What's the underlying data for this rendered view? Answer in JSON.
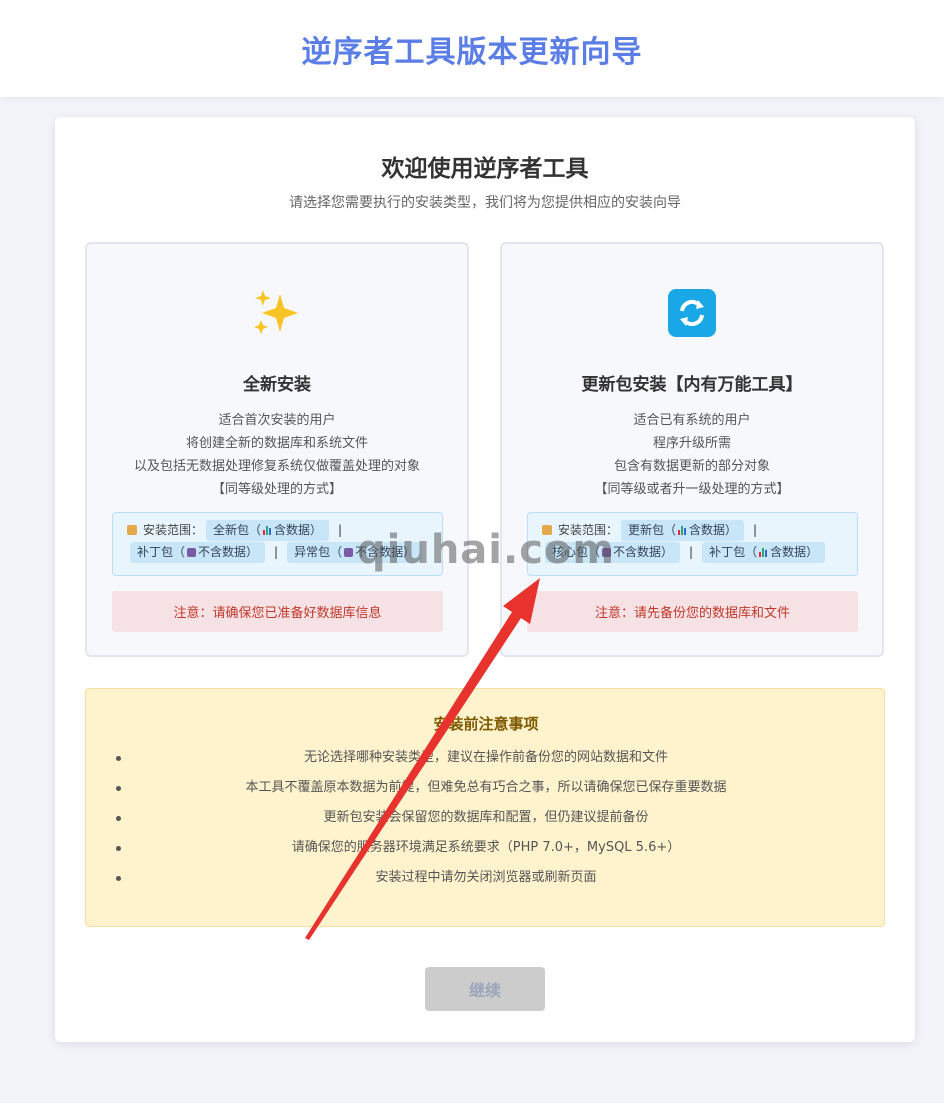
{
  "header": {
    "title": "逆序者工具版本更新向导"
  },
  "welcome": {
    "title": "欢迎使用逆序者工具",
    "subtitle": "请选择您需要执行的安装类型，我们将为您提供相应的安装向导"
  },
  "options": [
    {
      "icon": "sparkles-icon",
      "title": "全新安装",
      "desc": [
        "适合首次安装的用户",
        "将创建全新的数据库和系统文件",
        "以及包括无数据处理修复系统仅做覆盖处理的对象",
        "【同等级处理的方式】"
      ],
      "scope_label": "安装范围：",
      "tags_row1": [
        "全新包（",
        "含数据）"
      ],
      "tags_row2a": [
        "补丁包（",
        "不含数据）"
      ],
      "tags_row2b": [
        "异常包（",
        "不含数据）"
      ],
      "separator": "|",
      "warning": "注意：请确保您已准备好数据库信息"
    },
    {
      "icon": "refresh-icon",
      "title": "更新包安装【内有万能工具】",
      "desc": [
        "适合已有系统的用户",
        "程序升级所需",
        "包含有数据更新的部分对象",
        "【同等级或者升一级处理的方式】"
      ],
      "scope_label": "安装范围：",
      "tags_row1": [
        "更新包（",
        "含数据）"
      ],
      "tags_row2a": [
        "核心包（",
        "不含数据）"
      ],
      "tags_row2b": [
        "补丁包（",
        "含数据）"
      ],
      "separator": "|",
      "warning": "注意：请先备份您的数据库和文件"
    }
  ],
  "notes": {
    "title": "安装前注意事项",
    "items": [
      "无论选择哪种安装类型，建议在操作前备份您的网站数据和文件",
      "本工具不覆盖原本数据为前提，但难免总有巧合之事，所以请确保您已保存重要数据",
      "更新包安装会保留您的数据库和配置，但仍建议提前备份",
      "请确保您的服务器环境满足系统要求（PHP 7.0+，MySQL 5.6+）",
      "安装过程中请勿关闭浏览器或刷新页面"
    ]
  },
  "continue_label": "继续",
  "watermark": "qiuhai.com",
  "colors": {
    "accent": "#5b7ee6",
    "warning_text": "#c0392b",
    "refresh_icon_bg": "#1aa7e8"
  }
}
